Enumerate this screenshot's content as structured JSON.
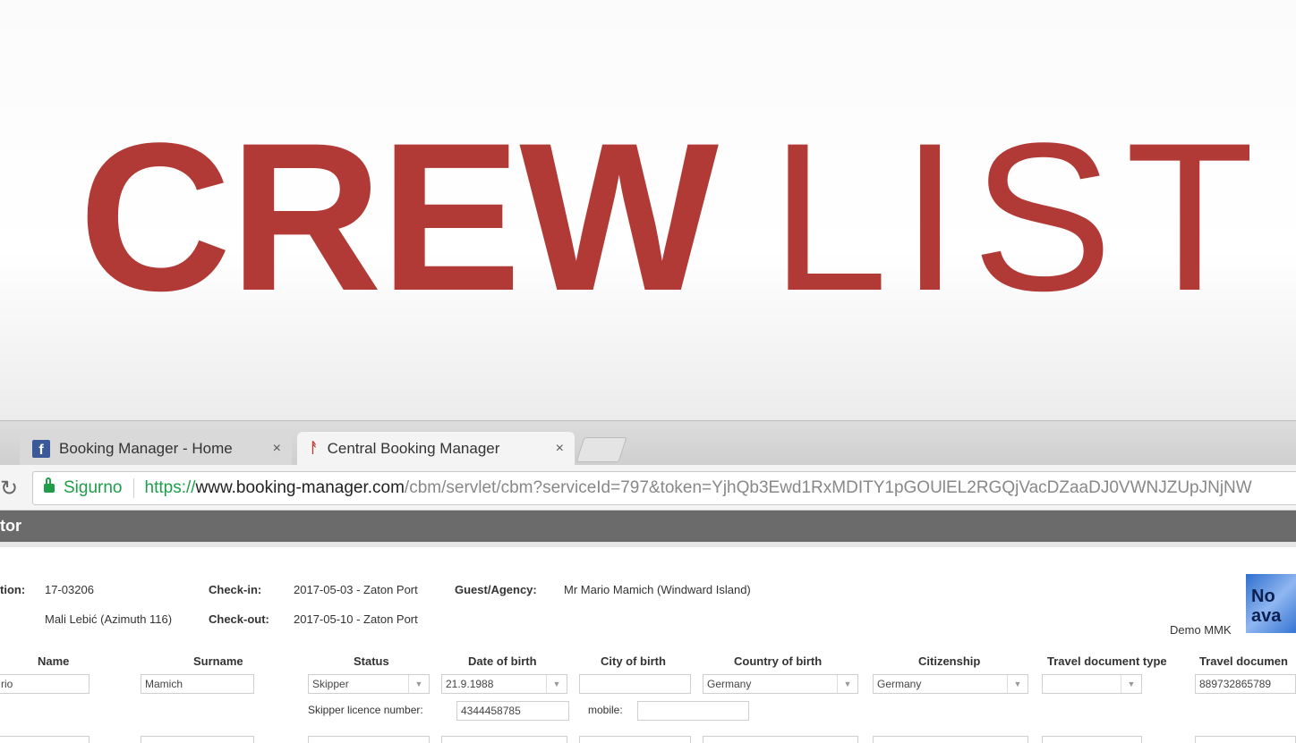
{
  "hero": {
    "title_bold": "CREW",
    "title_light": "LIST",
    "color": "#b23a36"
  },
  "browser": {
    "tabs": [
      {
        "label": "Booking Manager - Home",
        "icon": "facebook-icon",
        "close": "×"
      },
      {
        "label": "Central Booking Manager",
        "icon": "booking-manager-icon",
        "close": "×"
      }
    ],
    "address": {
      "secure_label": "Sigurno",
      "scheme": "https://",
      "host": "www.booking-manager.com",
      "path": "/cbm/servlet/cbm?serviceId=797&token=YjhQb3Ewd1RxMDITY1pGOUlEL2RGQjVacDZaaDJ0VWNJZUpJNjNW"
    }
  },
  "app": {
    "header_title": "tor",
    "info": {
      "reservation_label": "tion:",
      "reservation_value": "17-03206",
      "yacht_value": "Mali Lebić (Azimuth 116)",
      "checkin_label": "Check-in:",
      "checkin_value": "2017-05-03 - Zaton Port",
      "checkout_label": "Check-out:",
      "checkout_value": "2017-05-10 - Zaton Port",
      "guest_label": "Guest/Agency:",
      "guest_value": "Mr Mario Mamich (Windward Island)",
      "company_label": "Demo MMK",
      "logo_text": "No ava"
    },
    "columns": {
      "name": "Name",
      "surname": "Surname",
      "status": "Status",
      "dob": "Date of birth",
      "city_birth": "City of birth",
      "country_birth": "Country of birth",
      "citizenship": "Citizenship",
      "doc_type": "Travel document type",
      "doc_number": "Travel documen"
    },
    "row": {
      "name": "rio",
      "surname": "Mamich",
      "status": "Skipper",
      "dob": "21.9.1988",
      "city_birth": "",
      "country_birth": "Germany",
      "citizenship": "Germany",
      "doc_type": "",
      "doc_number": "889732865789"
    },
    "extra": {
      "skipper_licence_label": "Skipper licence number:",
      "skipper_licence_value": "4344458785",
      "mobile_label": "mobile:",
      "mobile_value": ""
    }
  }
}
